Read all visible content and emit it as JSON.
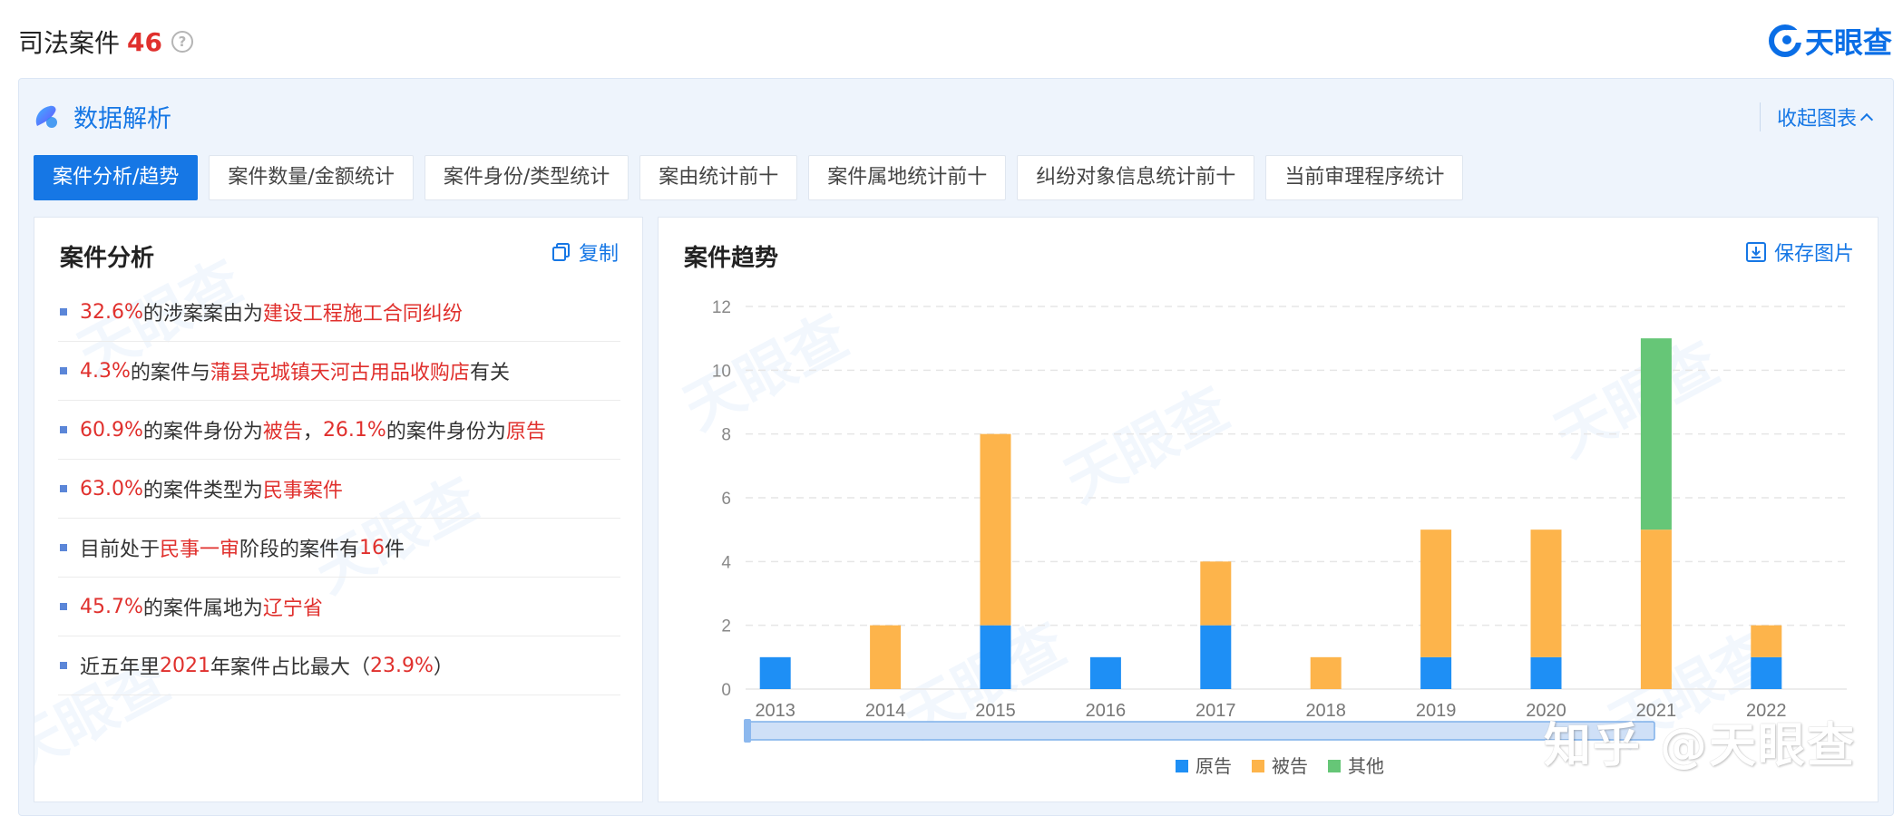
{
  "header": {
    "title": "司法案件",
    "count": "46",
    "help_icon": "question-circle-icon",
    "brand_name": "天眼查",
    "brand_icon": "tianyancha-logo-icon",
    "brand_color": "#0a6ee6"
  },
  "panel": {
    "title": "数据解析",
    "title_icon": "data-analysis-icon",
    "collapse_label": "收起图表",
    "collapse_icon": "chevron-up-icon"
  },
  "tabs": [
    {
      "label": "案件分析/趋势",
      "active": true
    },
    {
      "label": "案件数量/金额统计",
      "active": false
    },
    {
      "label": "案件身份/类型统计",
      "active": false
    },
    {
      "label": "案由统计前十",
      "active": false
    },
    {
      "label": "案件属地统计前十",
      "active": false
    },
    {
      "label": "纠纷对象信息统计前十",
      "active": false
    },
    {
      "label": "当前审理程序统计",
      "active": false
    }
  ],
  "analysis": {
    "title": "案件分析",
    "copy_label": "复制",
    "copy_icon": "copy-icon",
    "items": [
      [
        {
          "t": "32.6%",
          "h": true
        },
        {
          "t": "的涉案案由为",
          "h": false
        },
        {
          "t": "建设工程施工合同纠纷",
          "h": true
        }
      ],
      [
        {
          "t": "4.3%",
          "h": true
        },
        {
          "t": "的案件与",
          "h": false
        },
        {
          "t": "蒲县克城镇天河古用品收购店",
          "h": true
        },
        {
          "t": "有关",
          "h": false
        }
      ],
      [
        {
          "t": "60.9%",
          "h": true
        },
        {
          "t": "的案件身份为",
          "h": false
        },
        {
          "t": "被告",
          "h": true
        },
        {
          "t": "，",
          "h": false
        },
        {
          "t": "26.1%",
          "h": true
        },
        {
          "t": "的案件身份为",
          "h": false
        },
        {
          "t": "原告",
          "h": true
        }
      ],
      [
        {
          "t": "63.0%",
          "h": true
        },
        {
          "t": "的案件类型为",
          "h": false
        },
        {
          "t": "民事案件",
          "h": true
        }
      ],
      [
        {
          "t": "目前处于",
          "h": false
        },
        {
          "t": "民事一审",
          "h": true
        },
        {
          "t": "阶段的案件有",
          "h": false
        },
        {
          "t": "16",
          "h": true
        },
        {
          "t": "件",
          "h": false
        }
      ],
      [
        {
          "t": "45.7%",
          "h": true
        },
        {
          "t": "的案件属地为",
          "h": false
        },
        {
          "t": "辽宁省",
          "h": true
        }
      ],
      [
        {
          "t": "近五年里",
          "h": false
        },
        {
          "t": "2021",
          "h": true
        },
        {
          "t": "年案件占比最大（",
          "h": false
        },
        {
          "t": "23.9%",
          "h": true
        },
        {
          "t": "）",
          "h": false
        }
      ]
    ]
  },
  "trend": {
    "title": "案件趋势",
    "save_label": "保存图片",
    "save_icon": "download-icon"
  },
  "chart_data": {
    "type": "bar",
    "stacked": true,
    "categories": [
      "2013",
      "2014",
      "2015",
      "2016",
      "2017",
      "2018",
      "2019",
      "2020",
      "2021",
      "2022"
    ],
    "series": [
      {
        "name": "原告",
        "color": "#1e8ff5",
        "values": [
          1,
          0,
          2,
          1,
          2,
          0,
          1,
          1,
          0,
          1
        ]
      },
      {
        "name": "被告",
        "color": "#fdb44b",
        "values": [
          0,
          2,
          6,
          0,
          2,
          1,
          4,
          4,
          5,
          1
        ]
      },
      {
        "name": "其他",
        "color": "#66c677",
        "values": [
          0,
          0,
          0,
          0,
          0,
          0,
          0,
          0,
          6,
          0
        ]
      }
    ],
    "yticks": [
      0,
      2,
      4,
      6,
      8,
      10,
      12
    ],
    "ylim": [
      0,
      12
    ],
    "grid": true,
    "legend_position": "bottom-center",
    "data_zoom": true
  },
  "watermarks": {
    "text": "天眼查",
    "overlay": "知乎 @天眼查"
  }
}
